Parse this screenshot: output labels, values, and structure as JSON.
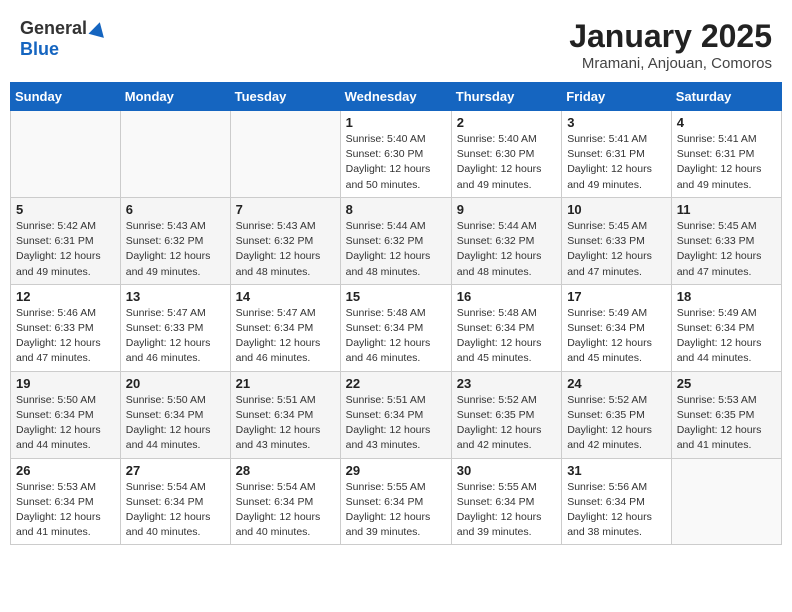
{
  "header": {
    "logo_general": "General",
    "logo_blue": "Blue",
    "month": "January 2025",
    "location": "Mramani, Anjouan, Comoros"
  },
  "weekdays": [
    "Sunday",
    "Monday",
    "Tuesday",
    "Wednesday",
    "Thursday",
    "Friday",
    "Saturday"
  ],
  "weeks": [
    [
      {
        "day": "",
        "info": ""
      },
      {
        "day": "",
        "info": ""
      },
      {
        "day": "",
        "info": ""
      },
      {
        "day": "1",
        "info": "Sunrise: 5:40 AM\nSunset: 6:30 PM\nDaylight: 12 hours\nand 50 minutes."
      },
      {
        "day": "2",
        "info": "Sunrise: 5:40 AM\nSunset: 6:30 PM\nDaylight: 12 hours\nand 49 minutes."
      },
      {
        "day": "3",
        "info": "Sunrise: 5:41 AM\nSunset: 6:31 PM\nDaylight: 12 hours\nand 49 minutes."
      },
      {
        "day": "4",
        "info": "Sunrise: 5:41 AM\nSunset: 6:31 PM\nDaylight: 12 hours\nand 49 minutes."
      }
    ],
    [
      {
        "day": "5",
        "info": "Sunrise: 5:42 AM\nSunset: 6:31 PM\nDaylight: 12 hours\nand 49 minutes."
      },
      {
        "day": "6",
        "info": "Sunrise: 5:43 AM\nSunset: 6:32 PM\nDaylight: 12 hours\nand 49 minutes."
      },
      {
        "day": "7",
        "info": "Sunrise: 5:43 AM\nSunset: 6:32 PM\nDaylight: 12 hours\nand 48 minutes."
      },
      {
        "day": "8",
        "info": "Sunrise: 5:44 AM\nSunset: 6:32 PM\nDaylight: 12 hours\nand 48 minutes."
      },
      {
        "day": "9",
        "info": "Sunrise: 5:44 AM\nSunset: 6:32 PM\nDaylight: 12 hours\nand 48 minutes."
      },
      {
        "day": "10",
        "info": "Sunrise: 5:45 AM\nSunset: 6:33 PM\nDaylight: 12 hours\nand 47 minutes."
      },
      {
        "day": "11",
        "info": "Sunrise: 5:45 AM\nSunset: 6:33 PM\nDaylight: 12 hours\nand 47 minutes."
      }
    ],
    [
      {
        "day": "12",
        "info": "Sunrise: 5:46 AM\nSunset: 6:33 PM\nDaylight: 12 hours\nand 47 minutes."
      },
      {
        "day": "13",
        "info": "Sunrise: 5:47 AM\nSunset: 6:33 PM\nDaylight: 12 hours\nand 46 minutes."
      },
      {
        "day": "14",
        "info": "Sunrise: 5:47 AM\nSunset: 6:34 PM\nDaylight: 12 hours\nand 46 minutes."
      },
      {
        "day": "15",
        "info": "Sunrise: 5:48 AM\nSunset: 6:34 PM\nDaylight: 12 hours\nand 46 minutes."
      },
      {
        "day": "16",
        "info": "Sunrise: 5:48 AM\nSunset: 6:34 PM\nDaylight: 12 hours\nand 45 minutes."
      },
      {
        "day": "17",
        "info": "Sunrise: 5:49 AM\nSunset: 6:34 PM\nDaylight: 12 hours\nand 45 minutes."
      },
      {
        "day": "18",
        "info": "Sunrise: 5:49 AM\nSunset: 6:34 PM\nDaylight: 12 hours\nand 44 minutes."
      }
    ],
    [
      {
        "day": "19",
        "info": "Sunrise: 5:50 AM\nSunset: 6:34 PM\nDaylight: 12 hours\nand 44 minutes."
      },
      {
        "day": "20",
        "info": "Sunrise: 5:50 AM\nSunset: 6:34 PM\nDaylight: 12 hours\nand 44 minutes."
      },
      {
        "day": "21",
        "info": "Sunrise: 5:51 AM\nSunset: 6:34 PM\nDaylight: 12 hours\nand 43 minutes."
      },
      {
        "day": "22",
        "info": "Sunrise: 5:51 AM\nSunset: 6:34 PM\nDaylight: 12 hours\nand 43 minutes."
      },
      {
        "day": "23",
        "info": "Sunrise: 5:52 AM\nSunset: 6:35 PM\nDaylight: 12 hours\nand 42 minutes."
      },
      {
        "day": "24",
        "info": "Sunrise: 5:52 AM\nSunset: 6:35 PM\nDaylight: 12 hours\nand 42 minutes."
      },
      {
        "day": "25",
        "info": "Sunrise: 5:53 AM\nSunset: 6:35 PM\nDaylight: 12 hours\nand 41 minutes."
      }
    ],
    [
      {
        "day": "26",
        "info": "Sunrise: 5:53 AM\nSunset: 6:34 PM\nDaylight: 12 hours\nand 41 minutes."
      },
      {
        "day": "27",
        "info": "Sunrise: 5:54 AM\nSunset: 6:34 PM\nDaylight: 12 hours\nand 40 minutes."
      },
      {
        "day": "28",
        "info": "Sunrise: 5:54 AM\nSunset: 6:34 PM\nDaylight: 12 hours\nand 40 minutes."
      },
      {
        "day": "29",
        "info": "Sunrise: 5:55 AM\nSunset: 6:34 PM\nDaylight: 12 hours\nand 39 minutes."
      },
      {
        "day": "30",
        "info": "Sunrise: 5:55 AM\nSunset: 6:34 PM\nDaylight: 12 hours\nand 39 minutes."
      },
      {
        "day": "31",
        "info": "Sunrise: 5:56 AM\nSunset: 6:34 PM\nDaylight: 12 hours\nand 38 minutes."
      },
      {
        "day": "",
        "info": ""
      }
    ]
  ]
}
